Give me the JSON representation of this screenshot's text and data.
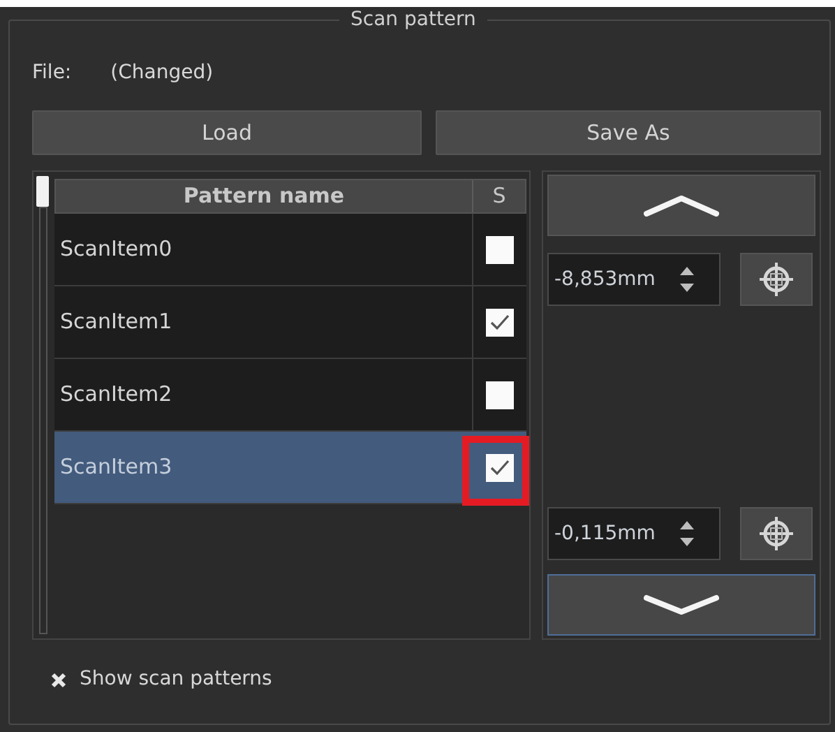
{
  "group": {
    "title": "Scan pattern"
  },
  "file": {
    "label": "File:",
    "value": "(Changed)"
  },
  "buttons": [
    "Load",
    "Save As"
  ],
  "table": {
    "columns": [
      "Pattern name",
      "S"
    ],
    "rows": [
      {
        "name": "ScanItem0",
        "checked": false,
        "selected": false,
        "highlighted": false
      },
      {
        "name": "ScanItem1",
        "checked": true,
        "selected": false,
        "highlighted": false
      },
      {
        "name": "ScanItem2",
        "checked": false,
        "selected": false,
        "highlighted": false
      },
      {
        "name": "ScanItem3",
        "checked": true,
        "selected": true,
        "highlighted": true
      }
    ]
  },
  "positions": [
    {
      "value": "-8,853mm"
    },
    {
      "value": "-0,115mm"
    }
  ],
  "show_scan_patterns": {
    "label": "Show scan patterns",
    "checked": true
  }
}
